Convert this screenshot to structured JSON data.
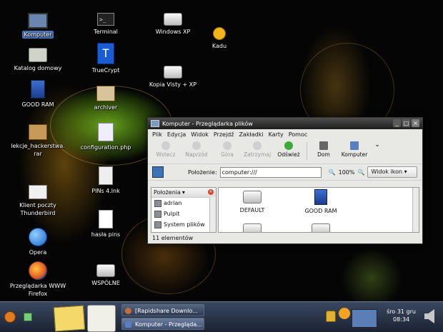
{
  "desktop": {
    "icons": [
      {
        "label": "Komputer"
      },
      {
        "label": "Terminal"
      },
      {
        "label": "Windows XP"
      },
      {
        "label": "Kadu"
      },
      {
        "label": "Katalog domowy"
      },
      {
        "label": "TrueCrypt"
      },
      {
        "label": "Kopia Visty + XP"
      },
      {
        "label": "GOOD RAM"
      },
      {
        "label": "archiver"
      },
      {
        "label": "lekcje_hackerstwa.\nrar"
      },
      {
        "label": "configuration.php"
      },
      {
        "label": "PINs 4.lnk"
      },
      {
        "label": "Klient poczty\nThunderbird"
      },
      {
        "label": "hasła pins"
      },
      {
        "label": "Opera"
      },
      {
        "label": "Przeglądarka WWW\nFirefox"
      },
      {
        "label": "WSPÓLNE"
      }
    ]
  },
  "window": {
    "title": "Komputer - Przeglądarka plików",
    "menu": [
      "Plik",
      "Edycja",
      "Widok",
      "Przejdź",
      "Zakładki",
      "Karty",
      "Pomoc"
    ],
    "toolbar": [
      "Wstecz",
      "Naprzód",
      "Góra",
      "Zatrzymaj",
      "Odśwież",
      "Dom",
      "Komputer"
    ],
    "location": {
      "label": "Położenie:",
      "value": "computer:///",
      "zoom": "100%",
      "view": "Widok ikon"
    },
    "sidebar": {
      "header": "Położenia",
      "items": [
        "adrian",
        "Pulpit",
        "System plików"
      ]
    },
    "files": [
      "DEFAULT",
      "GOOD RAM"
    ],
    "status": "11 elementów"
  },
  "taskbar": {
    "tasks": [
      "[Rapidshare Downlo...",
      "Komputer - Przegląda..."
    ],
    "clock": {
      "date": "śro 31 gru",
      "time": "08:34"
    }
  }
}
